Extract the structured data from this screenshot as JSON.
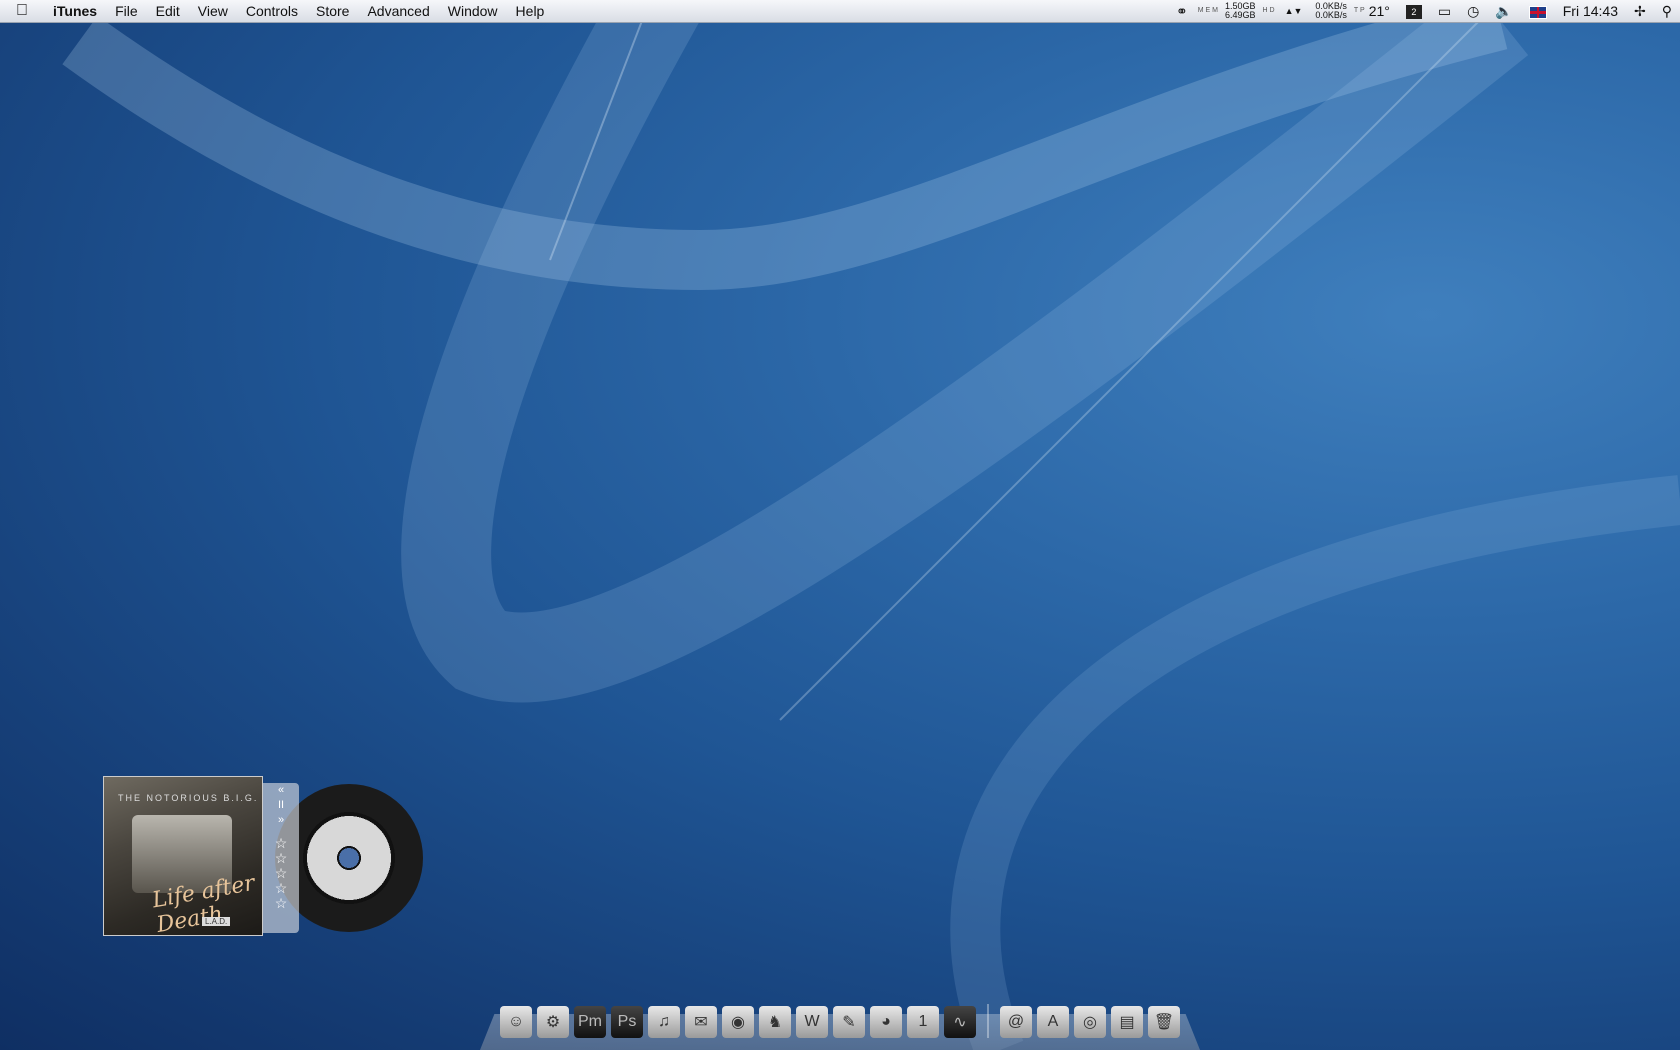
{
  "menubar": {
    "apple_icon": "apple-logo-icon",
    "app_name": "iTunes",
    "items": [
      "File",
      "Edit",
      "View",
      "Controls",
      "Store",
      "Advanced",
      "Window",
      "Help"
    ],
    "status": {
      "mem_label_top": "M E M",
      "mem_used": "1.50GB",
      "mem_free": "6.49GB",
      "disk_label": "H D",
      "net_up": "0.0KB/s",
      "net_down": "0.0KB/s",
      "temp_label": "T P",
      "temp": "21°",
      "clock": "Fri 14:43"
    }
  },
  "widget": {
    "album_artist": "THE NOTORIOUS B.I.G.",
    "album_title": "Life after Death",
    "plate": "L.A.D.",
    "controls": {
      "prev": "«",
      "pause": "II",
      "next": "»"
    },
    "rating_stars": 0,
    "star_glyph": "☆"
  },
  "dock": {
    "items": [
      {
        "name": "finder-icon",
        "glyph": "☺",
        "dark": false
      },
      {
        "name": "system-preferences-icon",
        "glyph": "⚙",
        "dark": false
      },
      {
        "name": "photoshop-elements-icon",
        "glyph": "Pm",
        "dark": true
      },
      {
        "name": "photoshop-icon",
        "glyph": "Ps",
        "dark": true
      },
      {
        "name": "itunes-icon",
        "glyph": "♫",
        "dark": false
      },
      {
        "name": "mail-icon",
        "glyph": "✉",
        "dark": false
      },
      {
        "name": "speaker-icon",
        "glyph": "◉",
        "dark": false
      },
      {
        "name": "preview-icon",
        "glyph": "♞",
        "dark": false
      },
      {
        "name": "textwrangler-icon",
        "glyph": "W",
        "dark": false
      },
      {
        "name": "script-editor-icon",
        "glyph": "✎",
        "dark": false
      },
      {
        "name": "firefox-icon",
        "glyph": "◕",
        "dark": false
      },
      {
        "name": "ical-icon",
        "glyph": "1",
        "dark": false
      },
      {
        "name": "activity-monitor-icon",
        "glyph": "∿",
        "dark": true
      }
    ],
    "stacks": [
      {
        "name": "documents-stack-icon",
        "glyph": "@"
      },
      {
        "name": "applications-stack-icon",
        "glyph": "A"
      },
      {
        "name": "downloads-stack-icon",
        "glyph": "◎"
      },
      {
        "name": "folder-stack-icon",
        "glyph": "▤"
      },
      {
        "name": "trash-icon",
        "glyph": "🗑"
      }
    ]
  }
}
